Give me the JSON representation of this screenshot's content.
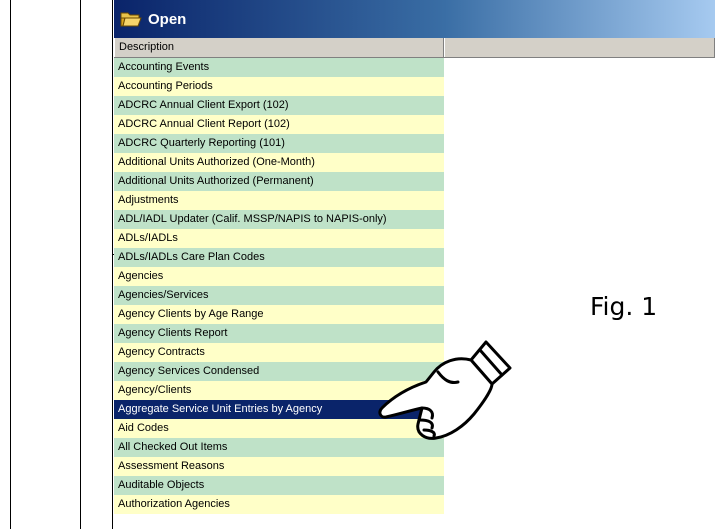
{
  "window": {
    "title": "Open",
    "icon": "folder-open-icon"
  },
  "columns": [
    "Description",
    ""
  ],
  "rows": [
    "Accounting Events",
    "Accounting Periods",
    "ADCRC Annual Client Export (102)",
    "ADCRC Annual Client Report (102)",
    "ADCRC Quarterly Reporting (101)",
    "Additional Units Authorized (One-Month)",
    "Additional Units Authorized (Permanent)",
    "Adjustments",
    "ADL/IADL Updater (Calif. MSSP/NAPIS to NAPIS-only)",
    "ADLs/IADLs",
    "ADLs/IADLs Care Plan Codes",
    "Agencies",
    "Agencies/Services",
    "Agency Clients by Age Range",
    "Agency Clients Report",
    "Agency Contracts",
    "Agency Services Condensed",
    "Agency/Clients",
    "Aggregate Service Unit Entries by Agency",
    "Aid Codes",
    "All Checked Out Items",
    "Assessment Reasons",
    "Auditable Objects",
    "Authorization Agencies"
  ],
  "selected_index": 18,
  "figure_label": "Fig. 1",
  "pointer_icon": "pointing-hand-icon",
  "colors": {
    "title_start": "#0a246a",
    "title_end": "#a6caf0",
    "row_green": "#bfe2c8",
    "row_yellow": "#ffffc8",
    "selected": "#0a246a"
  }
}
